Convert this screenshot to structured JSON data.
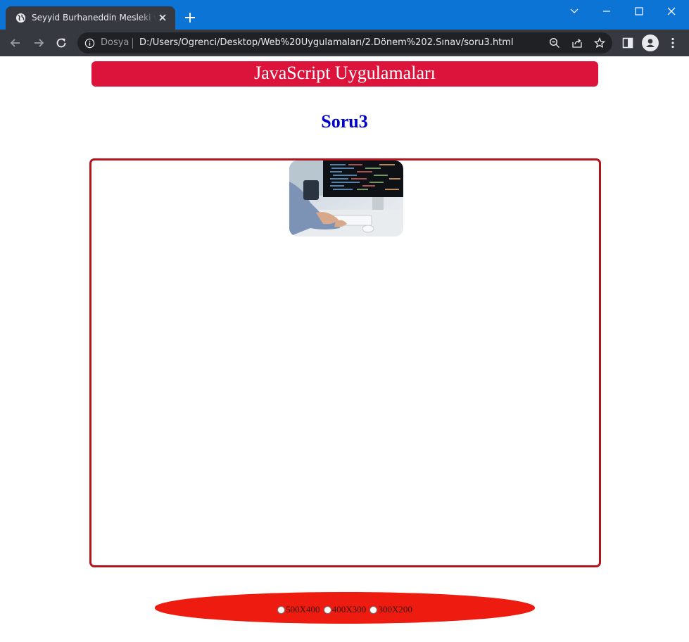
{
  "browser": {
    "tab_title": "Seyyid Burhaneddin Mesleki ve Teknik Anadolu Lisesi",
    "scheme_label": "Dosya",
    "url": "D:/Users/Ogrenci/Desktop/Web%20Uygulamaları/2.Dönem%202.Sınav/soru3.html"
  },
  "page": {
    "header": "JavaScript Uygulamaları",
    "heading": "Soru3",
    "size_options": [
      {
        "label": "500X400",
        "checked": false
      },
      {
        "label": "400X300",
        "checked": false
      },
      {
        "label": "300X200",
        "checked": false
      }
    ]
  },
  "colors": {
    "chrome_titlebar": "#0b74d5",
    "chrome_toolbar": "#36393f",
    "header_bar": "#dc143c",
    "heading": "#0000cd",
    "frame_border": "#b4141c",
    "footer_bar": "#ee1c10"
  },
  "icons": {
    "tab_favicon": "globe-icon",
    "tab_close": "close-icon",
    "new_tab": "plus-icon",
    "back": "back-arrow-icon",
    "forward": "forward-arrow-icon",
    "reload": "reload-icon",
    "site_info": "info-icon",
    "zoom": "zoom-icon",
    "share": "share-icon",
    "bookmark": "star-icon",
    "side_panel": "side-panel-icon",
    "profile": "profile-icon",
    "menu": "kebab-menu-icon",
    "photo": "developer-coding-photo"
  }
}
